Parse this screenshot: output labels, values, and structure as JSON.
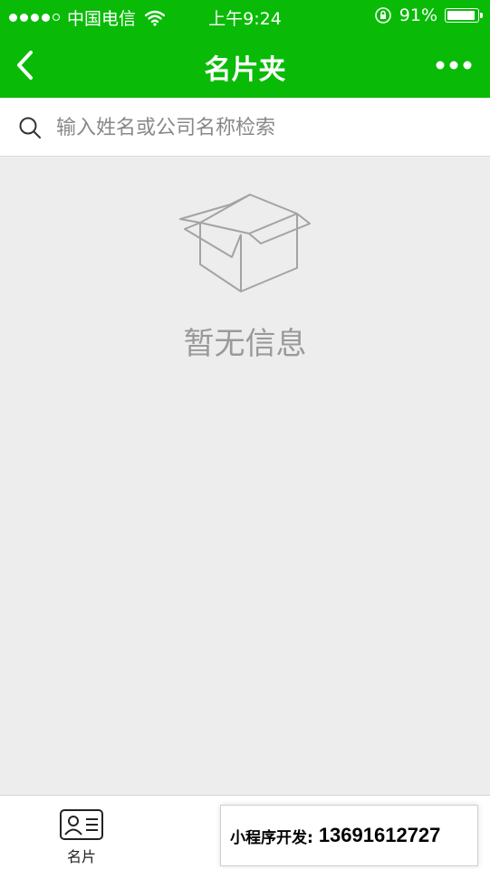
{
  "status_bar": {
    "carrier": "中国电信",
    "time": "上午9:24",
    "battery_percent": "91%",
    "battery_level": 0.91,
    "signal_bars": 4
  },
  "nav": {
    "title": "名片夹"
  },
  "search": {
    "placeholder": "输入姓名或公司名称检索"
  },
  "empty": {
    "text": "暂无信息"
  },
  "tabbar": {
    "items": [
      {
        "label": "名片",
        "icon": "id-card-icon"
      }
    ]
  },
  "promo": {
    "label": "小程序开发:",
    "phone": "13691612727"
  },
  "colors": {
    "accent": "#09bb07",
    "background": "#ededed"
  }
}
